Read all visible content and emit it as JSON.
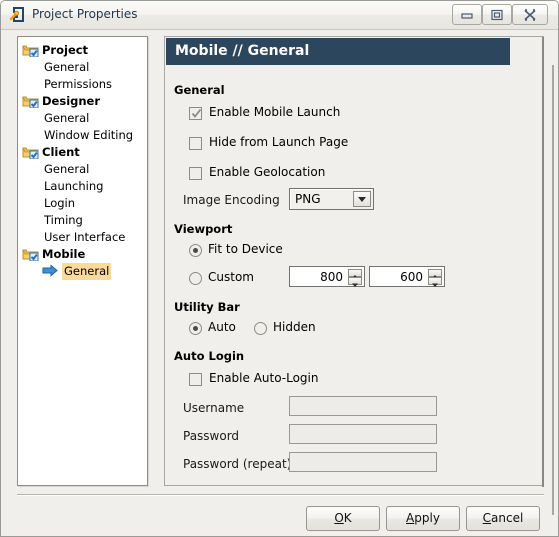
{
  "window": {
    "title": "Project Properties",
    "icon": "project-properties-icon",
    "controls": {
      "minimize": "minimize-icon",
      "maximize": "maximize-icon",
      "close": "close-icon"
    }
  },
  "tree": {
    "items": [
      {
        "label": "Project",
        "level": 0,
        "icon": "folder-check-icon",
        "selected": false
      },
      {
        "label": "General",
        "level": 1,
        "icon": "",
        "selected": false
      },
      {
        "label": "Permissions",
        "level": 1,
        "icon": "",
        "selected": false
      },
      {
        "label": "Designer",
        "level": 0,
        "icon": "folder-check-icon",
        "selected": false
      },
      {
        "label": "General",
        "level": 1,
        "icon": "",
        "selected": false
      },
      {
        "label": "Window Editing",
        "level": 1,
        "icon": "",
        "selected": false
      },
      {
        "label": "Client",
        "level": 0,
        "icon": "folder-check-icon",
        "selected": false
      },
      {
        "label": "General",
        "level": 1,
        "icon": "",
        "selected": false
      },
      {
        "label": "Launching",
        "level": 1,
        "icon": "",
        "selected": false
      },
      {
        "label": "Login",
        "level": 1,
        "icon": "",
        "selected": false
      },
      {
        "label": "Timing",
        "level": 1,
        "icon": "",
        "selected": false
      },
      {
        "label": "User Interface",
        "level": 1,
        "icon": "",
        "selected": false
      },
      {
        "label": "Mobile",
        "level": 0,
        "icon": "folder-check-icon",
        "selected": false
      },
      {
        "label": "General",
        "level": 1,
        "icon": "arrow-right-icon",
        "selected": true
      }
    ]
  },
  "content": {
    "header": "Mobile // General",
    "sections": {
      "general": {
        "title": "General",
        "enable_mobile_launch": {
          "label": "Enable Mobile Launch",
          "checked": true
        },
        "hide_from_launch_page": {
          "label": "Hide from Launch Page",
          "checked": false
        },
        "enable_geolocation": {
          "label": "Enable Geolocation",
          "checked": false
        },
        "image_encoding": {
          "label": "Image Encoding",
          "value": "PNG"
        }
      },
      "viewport": {
        "title": "Viewport",
        "fit_to_device": {
          "label": "Fit to Device",
          "selected": true
        },
        "custom": {
          "label": "Custom",
          "selected": false
        },
        "width": "800",
        "height": "600"
      },
      "utility_bar": {
        "title": "Utility Bar",
        "auto": {
          "label": "Auto",
          "selected": true
        },
        "hidden": {
          "label": "Hidden",
          "selected": false
        }
      },
      "auto_login": {
        "title": "Auto Login",
        "enable": {
          "label": "Enable Auto-Login",
          "checked": false
        },
        "username": {
          "label": "Username",
          "value": ""
        },
        "password": {
          "label": "Password",
          "value": ""
        },
        "password_repeat": {
          "label": "Password (repeat)",
          "value": ""
        }
      }
    }
  },
  "buttons": {
    "ok": {
      "mnemonic": "O",
      "rest": "K"
    },
    "apply": {
      "mnemonic": "A",
      "rest": "pply"
    },
    "cancel": {
      "mnemonic": "C",
      "rest": "ancel"
    }
  },
  "colors": {
    "header_bar": "#2c465e",
    "selection_highlight": "#fbd999",
    "window_bg": "#f0efeb",
    "title_text": "#20384f"
  }
}
